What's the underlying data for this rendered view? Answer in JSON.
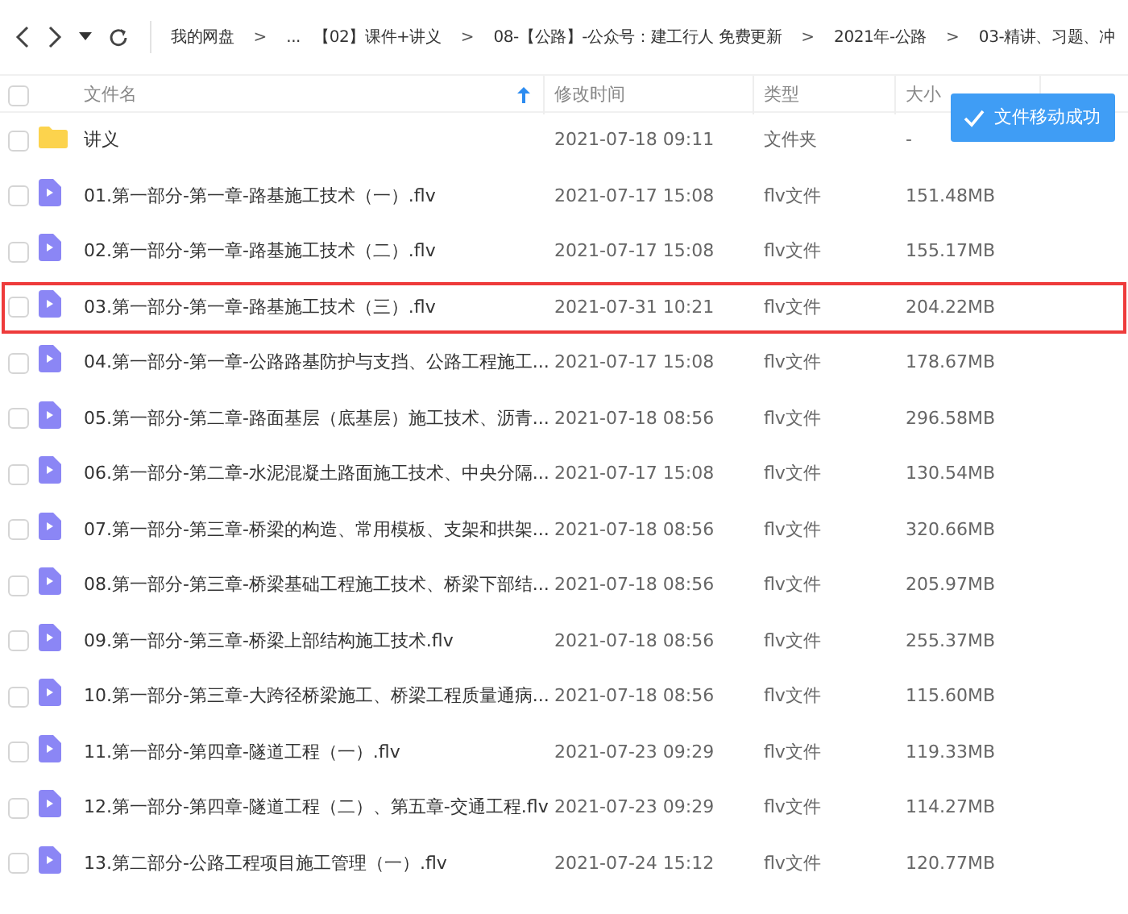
{
  "toolbar": {
    "breadcrumb": [
      {
        "kind": "crumb",
        "text": "我的网盘"
      },
      {
        "kind": "sep",
        "text": ">"
      },
      {
        "kind": "crumb",
        "text": "..."
      },
      {
        "kind": "crumb",
        "text": "【02】课件+讲义"
      },
      {
        "kind": "sep",
        "text": ">"
      },
      {
        "kind": "crumb",
        "text": "08-【公路】-公众号：建工行人 免费更新"
      },
      {
        "kind": "sep",
        "text": ">"
      },
      {
        "kind": "crumb",
        "text": "2021年-公路"
      },
      {
        "kind": "sep",
        "text": ">"
      },
      {
        "kind": "crumb",
        "text": "03-精讲、习题、冲"
      }
    ]
  },
  "table": {
    "select_all_checked": false,
    "columns": [
      {
        "label": "文件名",
        "sorted": true
      },
      {
        "label": "修改时间",
        "sorted": false
      },
      {
        "label": "类型",
        "sorted": false
      },
      {
        "label": "大小",
        "sorted": false
      }
    ],
    "rows": [
      {
        "kind": "folder",
        "name": "讲义",
        "modified": "2021-07-18 09:11",
        "type": "文件夹",
        "size": "-",
        "checked": false,
        "highlighted": false
      },
      {
        "kind": "video",
        "name": "01.第一部分-第一章-路基施工技术（一）.flv",
        "modified": "2021-07-17 15:08",
        "type": "flv文件",
        "size": "151.48MB",
        "checked": false,
        "highlighted": false
      },
      {
        "kind": "video",
        "name": "02.第一部分-第一章-路基施工技术（二）.flv",
        "modified": "2021-07-17 15:08",
        "type": "flv文件",
        "size": "155.17MB",
        "checked": false,
        "highlighted": false
      },
      {
        "kind": "video",
        "name": "03.第一部分-第一章-路基施工技术（三）.flv",
        "modified": "2021-07-31 10:21",
        "type": "flv文件",
        "size": "204.22MB",
        "checked": false,
        "highlighted": true
      },
      {
        "kind": "video",
        "name": "04.第一部分-第一章-公路路基防护与支挡、公路工程施工...",
        "modified": "2021-07-17 15:08",
        "type": "flv文件",
        "size": "178.67MB",
        "checked": false,
        "highlighted": false
      },
      {
        "kind": "video",
        "name": "05.第一部分-第二章-路面基层（底基层）施工技术、沥青...",
        "modified": "2021-07-18 08:56",
        "type": "flv文件",
        "size": "296.58MB",
        "checked": false,
        "highlighted": false
      },
      {
        "kind": "video",
        "name": "06.第一部分-第二章-水泥混凝土路面施工技术、中央分隔...",
        "modified": "2021-07-17 15:08",
        "type": "flv文件",
        "size": "130.54MB",
        "checked": false,
        "highlighted": false
      },
      {
        "kind": "video",
        "name": "07.第一部分-第三章-桥梁的构造、常用模板、支架和拱架...",
        "modified": "2021-07-18 08:56",
        "type": "flv文件",
        "size": "320.66MB",
        "checked": false,
        "highlighted": false
      },
      {
        "kind": "video",
        "name": "08.第一部分-第三章-桥梁基础工程施工技术、桥梁下部结...",
        "modified": "2021-07-18 08:56",
        "type": "flv文件",
        "size": "205.97MB",
        "checked": false,
        "highlighted": false
      },
      {
        "kind": "video",
        "name": "09.第一部分-第三章-桥梁上部结构施工技术.flv",
        "modified": "2021-07-18 08:56",
        "type": "flv文件",
        "size": "255.37MB",
        "checked": false,
        "highlighted": false
      },
      {
        "kind": "video",
        "name": "10.第一部分-第三章-大跨径桥梁施工、桥梁工程质量通病...",
        "modified": "2021-07-18 08:56",
        "type": "flv文件",
        "size": "115.60MB",
        "checked": false,
        "highlighted": false
      },
      {
        "kind": "video",
        "name": "11.第一部分-第四章-隧道工程（一）.flv",
        "modified": "2021-07-23 09:29",
        "type": "flv文件",
        "size": "119.33MB",
        "checked": false,
        "highlighted": false
      },
      {
        "kind": "video",
        "name": "12.第一部分-第四章-隧道工程（二）、第五章-交通工程.flv",
        "modified": "2021-07-23 09:29",
        "type": "flv文件",
        "size": "114.27MB",
        "checked": false,
        "highlighted": false
      },
      {
        "kind": "video",
        "name": "13.第二部分-公路工程项目施工管理（一）.flv",
        "modified": "2021-07-24 15:12",
        "type": "flv文件",
        "size": "120.77MB",
        "checked": false,
        "highlighted": false
      }
    ]
  },
  "toast": {
    "text": "文件移动成功"
  }
}
